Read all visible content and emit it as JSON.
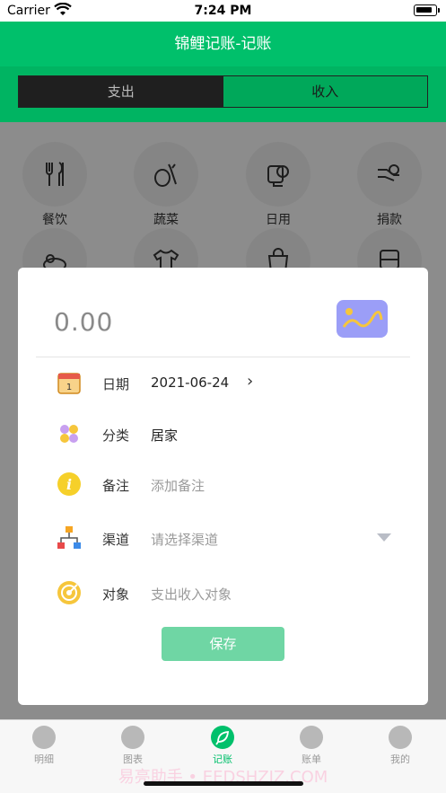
{
  "status": {
    "carrier": "Carrier",
    "time": "7:24 PM"
  },
  "nav": {
    "title": "锦鲤记账-记账"
  },
  "segment": {
    "options": [
      "支出",
      "收入"
    ],
    "selected": "支出"
  },
  "categories": [
    {
      "label": "餐饮",
      "icon": "fork-knife-icon"
    },
    {
      "label": "蔬菜",
      "icon": "vegetables-icon"
    },
    {
      "label": "日用",
      "icon": "tissue-roll-icon"
    },
    {
      "label": "捐款",
      "icon": "donation-hand-icon"
    },
    {
      "label": "",
      "icon": "fruit-bowl-icon"
    },
    {
      "label": "",
      "icon": "tshirt-icon"
    },
    {
      "label": "",
      "icon": "shopping-bag-icon"
    },
    {
      "label": "",
      "icon": "bus-icon"
    }
  ],
  "modal": {
    "amount": "0.00",
    "image_icon": "image-icon",
    "rows": {
      "date": {
        "label": "日期",
        "value": "2021-06-24",
        "icon": "calendar-icon"
      },
      "category": {
        "label": "分类",
        "value": "居家",
        "icon": "category-grid-icon"
      },
      "note": {
        "label": "备注",
        "placeholder": "添加备注",
        "icon": "info-icon"
      },
      "channel": {
        "label": "渠道",
        "placeholder": "请选择渠道",
        "icon": "network-icon"
      },
      "target": {
        "label": "对象",
        "placeholder": "支出收入对象",
        "icon": "target-icon"
      }
    },
    "save_label": "保存"
  },
  "tabbar": {
    "items": [
      {
        "label": "明细",
        "icon": "detail-icon",
        "active": false
      },
      {
        "label": "图表",
        "icon": "chart-icon",
        "active": false
      },
      {
        "label": "记账",
        "icon": "leaf-icon",
        "active": true
      },
      {
        "label": "账单",
        "icon": "bill-icon",
        "active": false
      },
      {
        "label": "我的",
        "icon": "profile-icon",
        "active": false
      }
    ],
    "watermark": "易亮助手 • EEDSHZIZ.COM"
  },
  "colors": {
    "brand_green": "#00c06b",
    "save_button": "#6fd6a4",
    "image_button": "#9b9ef7"
  }
}
